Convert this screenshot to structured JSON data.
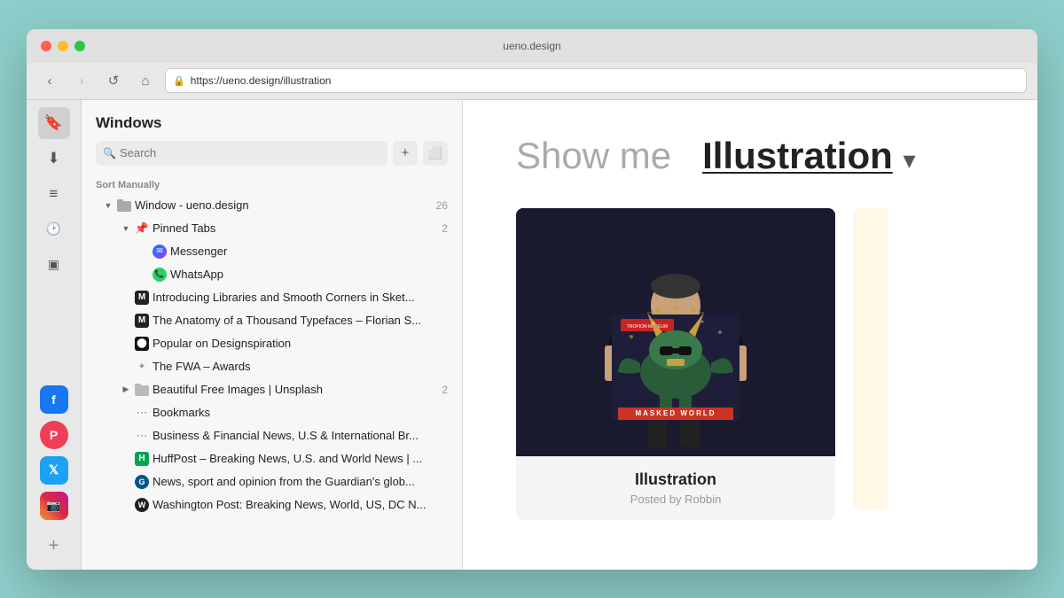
{
  "window": {
    "title": "ueno.design",
    "url": "https://ueno.design/illustration"
  },
  "nav": {
    "back_icon": "‹",
    "forward_icon": "›",
    "reload_icon": "↺",
    "home_icon": "⌂",
    "lock_icon": "🔒"
  },
  "sidebar_icons": [
    {
      "name": "bookmarks",
      "icon": "🔖"
    },
    {
      "name": "downloads",
      "icon": "⬇"
    },
    {
      "name": "reading-list",
      "icon": "≡"
    },
    {
      "name": "history",
      "icon": "🕐"
    },
    {
      "name": "tabs",
      "icon": "▣"
    }
  ],
  "social_icons": [
    {
      "name": "facebook",
      "label": "f",
      "class": "fb-icon"
    },
    {
      "name": "pocket",
      "label": "P",
      "class": "pocket-icon"
    },
    {
      "name": "twitter",
      "label": "t",
      "class": "tw-icon"
    },
    {
      "name": "instagram",
      "label": "📷",
      "class": "ig-icon"
    }
  ],
  "panel": {
    "title": "Windows",
    "search_placeholder": "Search",
    "sort_label": "Sort Manually",
    "add_icon": "+",
    "new_window_icon": "⬜"
  },
  "tree": {
    "window_label": "Window - ueno.design",
    "window_count": "26",
    "pinned_tabs_label": "Pinned Tabs",
    "pinned_tabs_count": "2",
    "items": [
      {
        "id": "messenger",
        "label": "Messenger",
        "type": "messenger",
        "indent": 3
      },
      {
        "id": "whatsapp",
        "label": "WhatsApp",
        "type": "whatsapp",
        "indent": 3
      },
      {
        "id": "sketch1",
        "label": "Introducing Libraries and Smooth Corners in Sket...",
        "type": "m",
        "indent": 2
      },
      {
        "id": "sketch2",
        "label": "The Anatomy of a Thousand Typefaces – Florian S...",
        "type": "m",
        "indent": 2
      },
      {
        "id": "designspiration",
        "label": "Popular on Designspiration",
        "type": "d-circle",
        "indent": 2
      },
      {
        "id": "fwa",
        "label": "The FWA – Awards",
        "type": "fwa",
        "indent": 2
      },
      {
        "id": "unsplash",
        "label": "Beautiful Free Images | Unsplash",
        "type": "folder",
        "count": "2",
        "indent": 2
      },
      {
        "id": "bookmarks",
        "label": "Bookmarks",
        "type": "dots",
        "indent": 2
      },
      {
        "id": "business",
        "label": "Business & Financial News, U.S & International Br...",
        "type": "dots",
        "indent": 2
      },
      {
        "id": "huffpost",
        "label": "HuffPost – Breaking News, U.S. and World News | ...",
        "type": "huffpost",
        "indent": 2
      },
      {
        "id": "guardian",
        "label": "News, sport and opinion from the Guardian's glob...",
        "type": "guardian",
        "indent": 2
      },
      {
        "id": "washpost",
        "label": "Washington Post: Breaking News, World, US, DC N...",
        "type": "wp",
        "indent": 2
      }
    ]
  },
  "main": {
    "heading_light": "Show me",
    "heading_strong": "Illustration",
    "heading_arrow": "▾",
    "card": {
      "title": "Illustration",
      "subtitle": "Posted by Robbin"
    }
  }
}
